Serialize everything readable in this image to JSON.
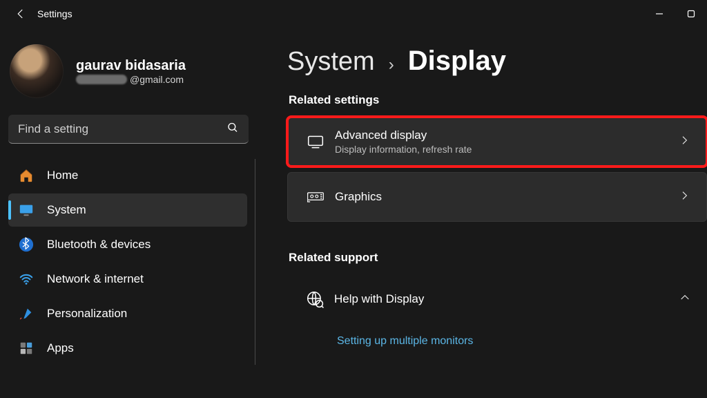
{
  "titlebar": {
    "title": "Settings"
  },
  "profile": {
    "name": "gaurav bidasaria",
    "email_domain": "@gmail.com"
  },
  "search": {
    "placeholder": "Find a setting"
  },
  "sidebar": {
    "items": [
      {
        "label": "Home"
      },
      {
        "label": "System"
      },
      {
        "label": "Bluetooth & devices"
      },
      {
        "label": "Network & internet"
      },
      {
        "label": "Personalization"
      },
      {
        "label": "Apps"
      }
    ]
  },
  "breadcrumb": {
    "parent": "System",
    "sep": "›",
    "current": "Display"
  },
  "sections": {
    "related_settings": "Related settings",
    "related_support": "Related support"
  },
  "cards": {
    "advanced": {
      "title": "Advanced display",
      "sub": "Display information, refresh rate"
    },
    "graphics": {
      "title": "Graphics"
    },
    "help": {
      "title": "Help with Display"
    }
  },
  "links": {
    "multiple_monitors": "Setting up multiple monitors"
  }
}
